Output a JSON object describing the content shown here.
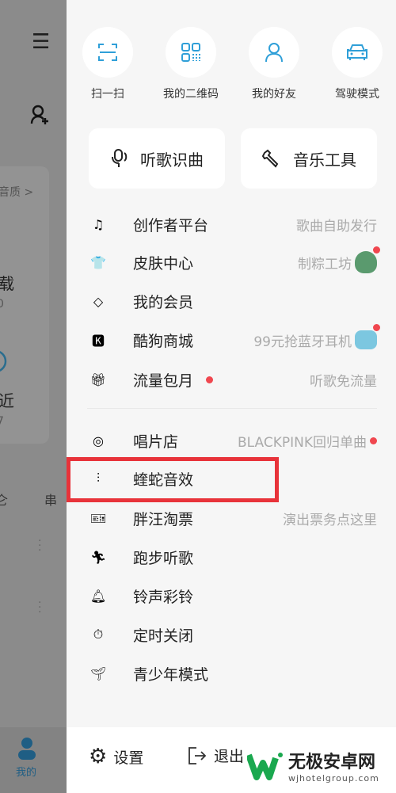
{
  "left_bg": {
    "quality_label": "音质 >",
    "download_label": "载",
    "download_count": "0",
    "recent_label": "近",
    "recent_count": "7",
    "tab_partial_1": "仑",
    "tab_partial_2": "串",
    "nav_me": "我的"
  },
  "quick_actions": [
    {
      "label": "扫一扫",
      "icon": "scan-icon"
    },
    {
      "label": "我的二维码",
      "icon": "qrcode-icon"
    },
    {
      "label": "我的好友",
      "icon": "friend-icon"
    },
    {
      "label": "驾驶模式",
      "icon": "car-icon"
    }
  ],
  "big_buttons": [
    {
      "label": "听歌识曲",
      "icon": "mic-icon"
    },
    {
      "label": "音乐工具",
      "icon": "wrench-icon"
    }
  ],
  "menu_group1": [
    {
      "label": "创作者平台",
      "right": "歌曲自助发行"
    },
    {
      "label": "皮肤中心",
      "right": "制粽工坊",
      "badge": true
    },
    {
      "label": "我的会员",
      "right": ""
    },
    {
      "label": "酷狗商城",
      "right": "99元抢蓝牙耳机",
      "badge": true
    },
    {
      "label": "流量包月",
      "right": "听歌免流量",
      "label_dot": true
    }
  ],
  "menu_group2": [
    {
      "label": "唱片店",
      "right": "BLACKPINK回归单曲",
      "right_dot": true
    },
    {
      "label": "蝰蛇音效",
      "right": "",
      "highlighted": true
    },
    {
      "label": "胖汪淘票",
      "right": "演出票务点这里"
    },
    {
      "label": "跑步听歌",
      "right": ""
    },
    {
      "label": "铃声彩铃",
      "right": ""
    },
    {
      "label": "定时关闭",
      "right": ""
    },
    {
      "label": "青少年模式",
      "right": ""
    }
  ],
  "bottom": {
    "settings": "设置",
    "logout": "退出"
  },
  "watermark": {
    "name": "无极安卓网",
    "url": "wjhotelgroup.com"
  },
  "colors": {
    "accent": "#2f9fd8",
    "badge": "#f0474f",
    "highlight": "#e8333a"
  }
}
